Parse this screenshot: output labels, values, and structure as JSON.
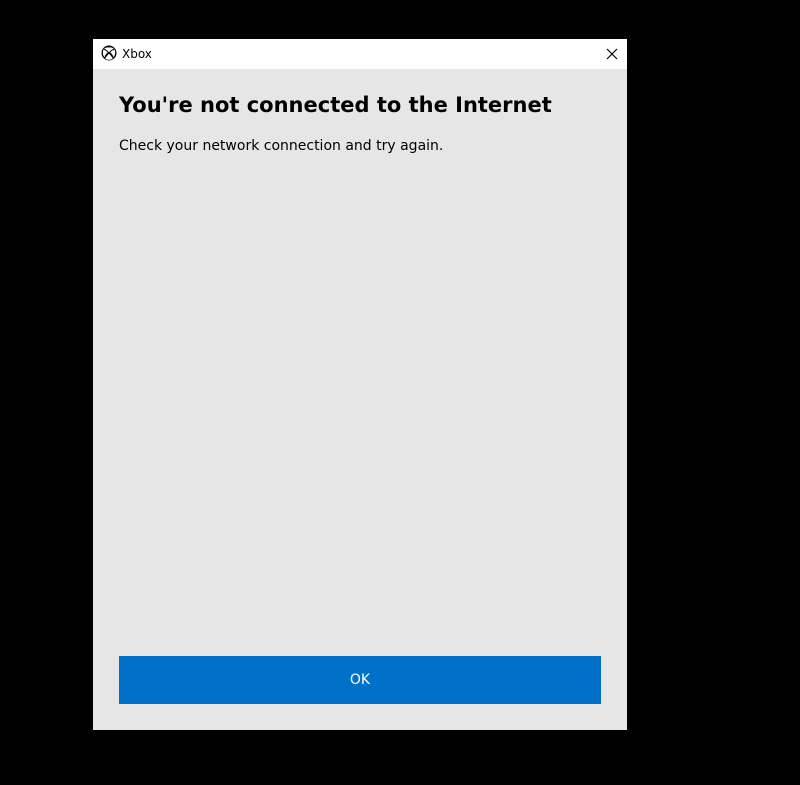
{
  "window": {
    "title": "Xbox",
    "app_icon": "xbox-logo-icon",
    "close_icon": "close-icon"
  },
  "dialog": {
    "heading": "You're not connected to the Internet",
    "message": "Check your network connection and try again.",
    "ok_label": "OK"
  },
  "colors": {
    "background": "#000000",
    "dialog_background": "#e6e6e6",
    "titlebar_background": "#ffffff",
    "accent": "#0070c9"
  }
}
